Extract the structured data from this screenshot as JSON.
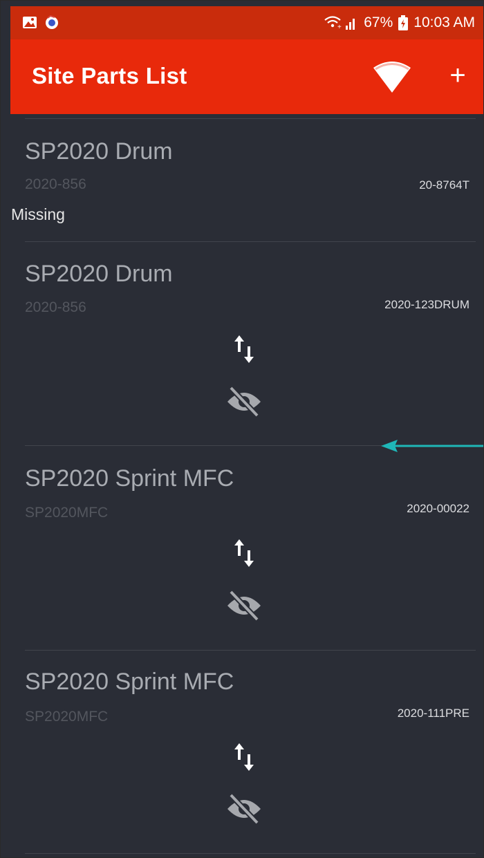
{
  "status_bar": {
    "battery": "67%",
    "time": "10:03 AM",
    "icons": [
      "gallery-icon",
      "app-notification-icon",
      "wifi-calling-icon",
      "signal-icon",
      "battery-icon"
    ]
  },
  "app_bar": {
    "title": "Site Parts List",
    "actions": [
      "wifi-icon",
      "add-icon"
    ]
  },
  "parts": [
    {
      "name": "SP2020 Drum",
      "part_number": "2020-856",
      "serial": "20-8764T",
      "status": "Missing"
    },
    {
      "name": "SP2020 Drum",
      "part_number": "2020-856",
      "serial": "2020-123DRUM"
    },
    {
      "name": "SP2020 Sprint MFC",
      "part_number": "SP2020MFC",
      "serial": "2020-00022"
    },
    {
      "name": "SP2020 Sprint MFC",
      "part_number": "SP2020MFC",
      "serial": "2020-111PRE"
    }
  ],
  "colors": {
    "status_bar": "#c92c0c",
    "app_bar": "#e8290b",
    "list_background": "#2a2d36",
    "annotation_arrow": "#1fb7b8"
  }
}
